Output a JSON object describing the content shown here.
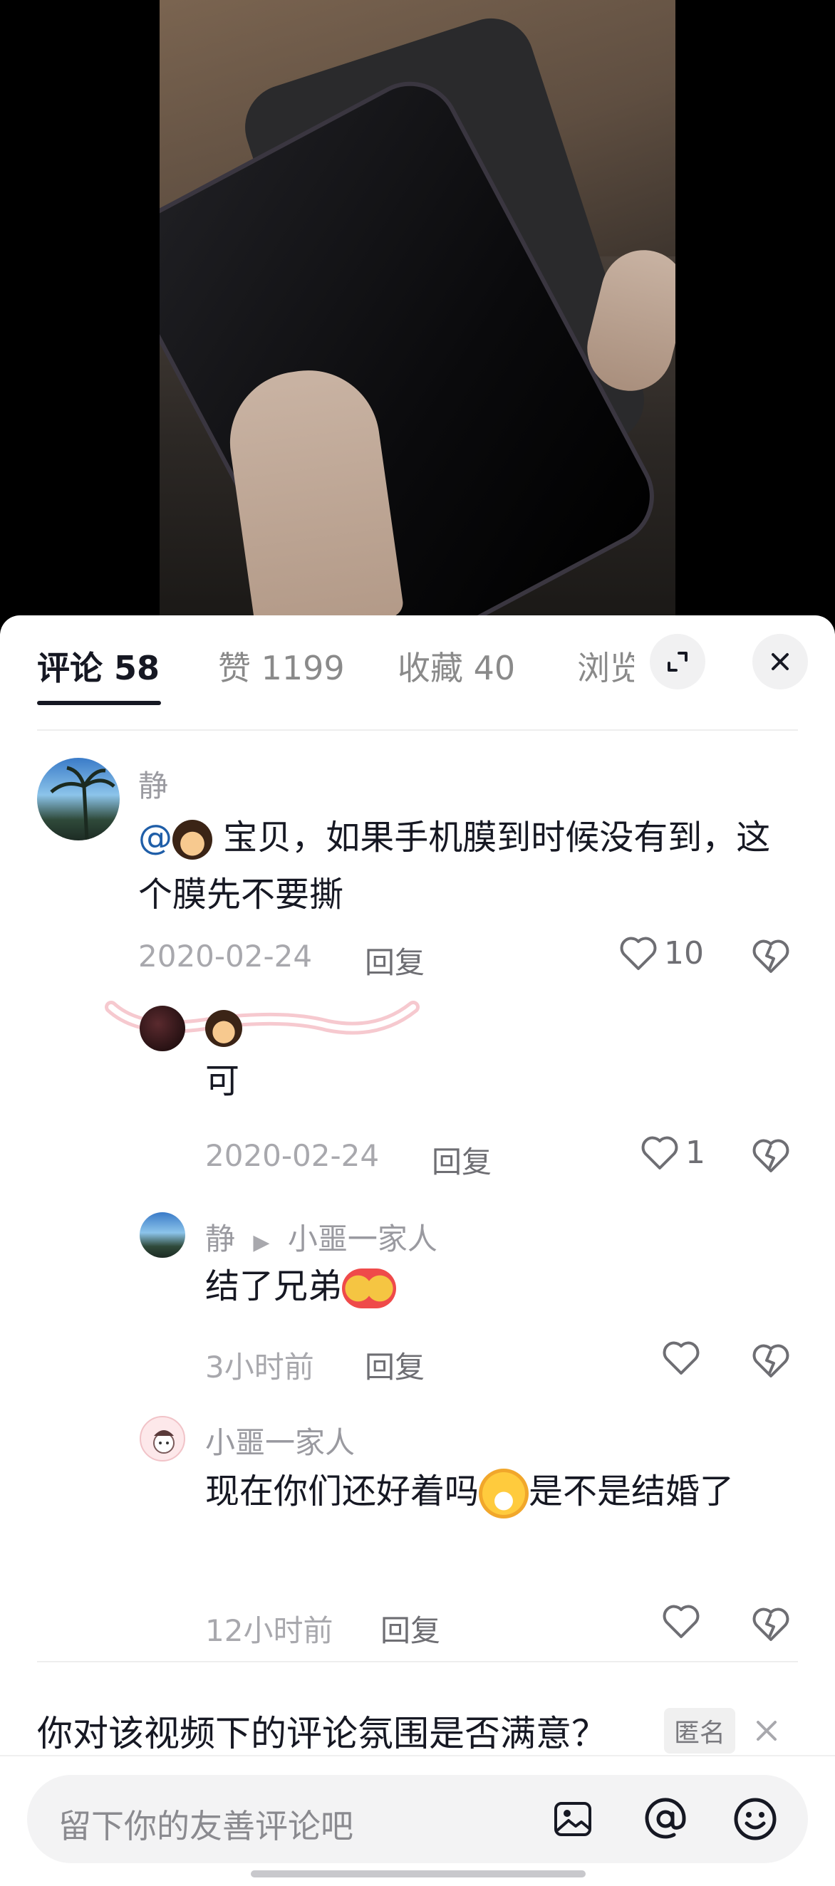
{
  "tabs": [
    {
      "label": "评论 58"
    },
    {
      "label": "赞 1199"
    },
    {
      "label": "收藏 40"
    },
    {
      "label": "浏览"
    }
  ],
  "comments": [
    {
      "username": "静",
      "text_mention": "@",
      "text": " 宝贝，如果手机膜到时候没有到，这个膜先不要撕",
      "date": "2020-02-24",
      "reply_label": "回复",
      "likes": "10"
    },
    {
      "username": "",
      "text": "可",
      "date": "2020-02-24",
      "reply_label": "回复",
      "likes": "1"
    },
    {
      "username": "静",
      "reply_to": "小噩一家人",
      "text": "结了兄弟",
      "date": "3小时前",
      "reply_label": "回复",
      "likes": ""
    },
    {
      "username": "小噩一家人",
      "text_a": "现在你们还好着吗",
      "text_b": "是不是结婚了",
      "date": "12小时前",
      "reply_label": "回复",
      "likes": ""
    }
  ],
  "survey": {
    "question": "你对该视频下的评论氛围是否满意？",
    "tag": "匿名"
  },
  "input": {
    "placeholder": "留下你的友善评论吧"
  },
  "icons": [
    "expand-icon",
    "close-icon",
    "heart-icon",
    "broken-heart-icon",
    "image-icon",
    "at-icon",
    "emoji-icon"
  ],
  "colors": {
    "text_primary": "#161823",
    "text_secondary": "#a8a8ad",
    "mention": "#1f5ea8"
  }
}
